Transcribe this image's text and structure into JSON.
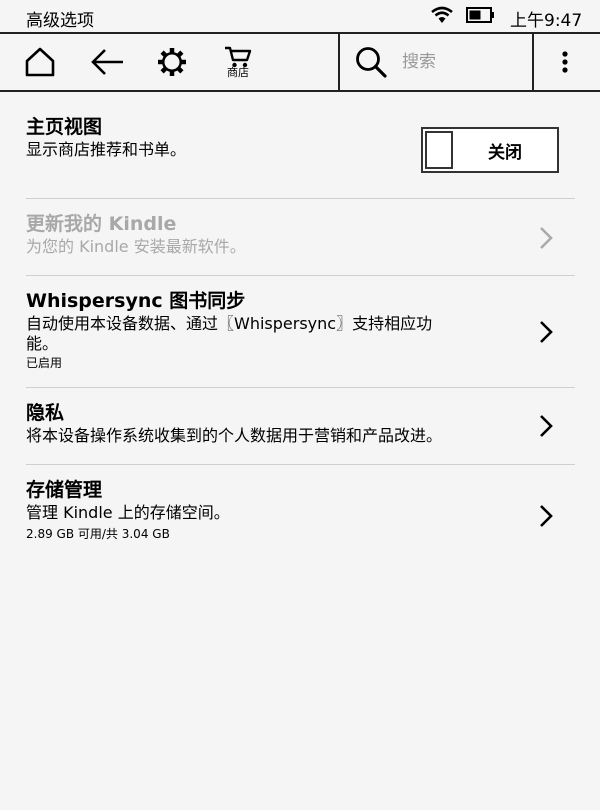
{
  "status_bar": {
    "title": "高级选项",
    "time": "上午9:47",
    "wifi_icon": "wifi-icon",
    "battery_icon": "battery-icon"
  },
  "toolbar": {
    "home_icon": "home-icon",
    "back_icon": "back-arrow-icon",
    "settings_icon": "gear-icon",
    "store_icon": "cart-icon",
    "store_label": "商店",
    "search_placeholder": "搜索",
    "menu_icon": "more-vertical-icon"
  },
  "settings": {
    "homepage_view": {
      "title": "主页视图",
      "description": "显示商店推荐和书单。",
      "toggle_label": "关闭"
    },
    "update_kindle": {
      "title": "更新我的 Kindle",
      "description": "为您的 Kindle 安装最新软件。",
      "enabled": false
    },
    "whispersync": {
      "title": "Whispersync 图书同步",
      "description_line1": "自动使用本设备数据、通过〖Whispersync〗支持相应功",
      "description_line2": "能。",
      "status": "已启用"
    },
    "privacy": {
      "title": "隐私",
      "description": "将本设备操作系统收集到的个人数据用于营销和产品改进。"
    },
    "storage": {
      "title": "存储管理",
      "description": "管理 Kindle 上的存储空间。",
      "usage": "2.89 GB 可用/共 3.04 GB"
    }
  },
  "colors": {
    "background": "#f5f5f5",
    "text": "#000000",
    "disabled_text": "#a8a8a8",
    "divider": "#cfcfcf"
  }
}
